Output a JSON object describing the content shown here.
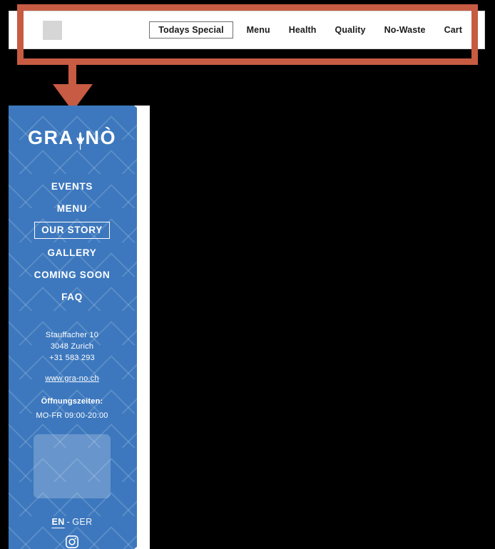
{
  "colors": {
    "annotation": "#c75b43",
    "sidebar_blue": "#3d78be",
    "nav_text": "#1b1b1b",
    "white": "#ffffff",
    "placeholder_gray": "#d6d6d6"
  },
  "topbar": {
    "brand_placeholder_name": "brand-logo-placeholder",
    "items": [
      {
        "label": "Todays Special",
        "active": true
      },
      {
        "label": "Menu",
        "active": false
      },
      {
        "label": "Health",
        "active": false
      },
      {
        "label": "Quality",
        "active": false
      },
      {
        "label": "No-Waste",
        "active": false
      },
      {
        "label": "Cart",
        "active": false
      }
    ]
  },
  "annotation": {
    "kind": "highlight-box-with-down-arrow",
    "target": "top-navigation-bar"
  },
  "sidebar": {
    "logo": {
      "text_before": "GRA",
      "icon": "wheat-stalk-icon",
      "text_after": "NÒ"
    },
    "items": [
      {
        "label": "EVENTS",
        "active": false
      },
      {
        "label": "MENU",
        "active": false
      },
      {
        "label": "OUR STORY",
        "active": true
      },
      {
        "label": "GALLERY",
        "active": false
      },
      {
        "label": "COMING SOON",
        "active": false
      },
      {
        "label": "FAQ",
        "active": false
      }
    ],
    "contact": {
      "street": "Stauffacher 10",
      "city": "3048 Zurich",
      "phone": "+31 583 293",
      "website": "www.gra-no.ch"
    },
    "hours": {
      "title": "Öffnungszeiten:",
      "value": "MO-FR 09:00-20:00"
    },
    "image_placeholder_name": "sidebar-image-placeholder",
    "language": {
      "primary": "EN",
      "separator": "-",
      "secondary": "GER"
    },
    "social": [
      {
        "name": "instagram-icon"
      }
    ]
  }
}
